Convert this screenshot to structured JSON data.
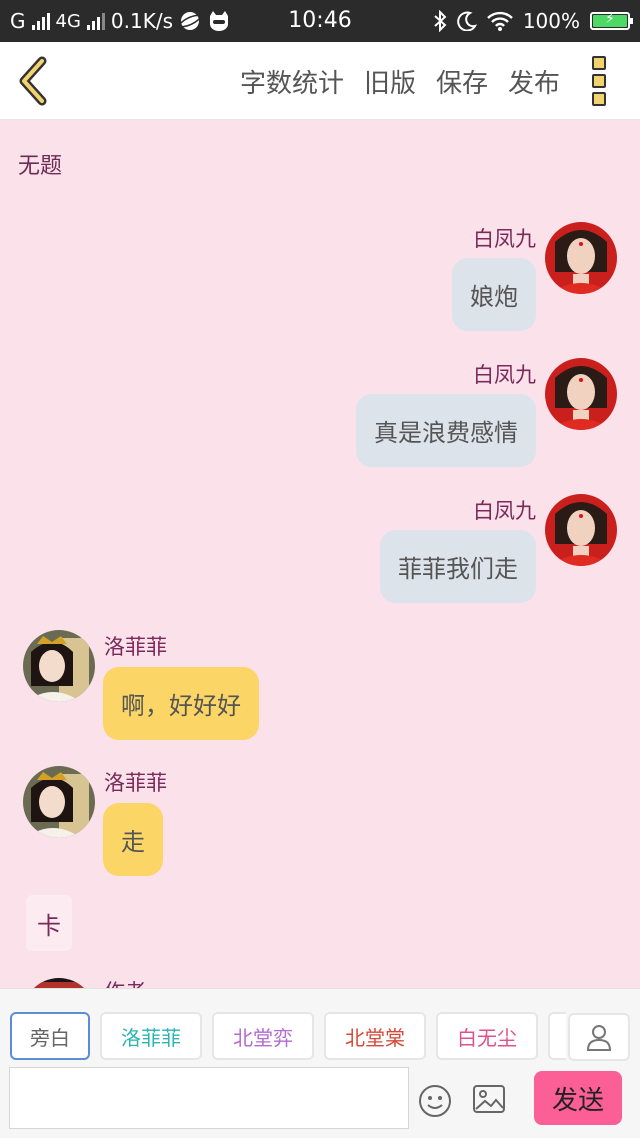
{
  "status_bar": {
    "carrier": "G",
    "network": "4G",
    "speed": "0.1K/s",
    "time": "10:46",
    "battery": "100%"
  },
  "nav": {
    "actions": [
      "字数统计",
      "旧版",
      "保存",
      "发布"
    ]
  },
  "document": {
    "title": "无题"
  },
  "messages": [
    {
      "side": "right",
      "name": "白凤九",
      "text": "娘炮"
    },
    {
      "side": "right",
      "name": "白凤九",
      "text": "真是浪费感情"
    },
    {
      "side": "right",
      "name": "白凤九",
      "text": "菲菲我们走"
    },
    {
      "side": "left",
      "name": "洛菲菲",
      "text": "啊，好好好"
    },
    {
      "side": "left",
      "name": "洛菲菲",
      "text": "走"
    }
  ],
  "narration": "卡",
  "partial_next_name": "作者",
  "roles": [
    {
      "label": "旁白",
      "color": "#666666"
    },
    {
      "label": "洛菲菲",
      "color": "#2bb5b0"
    },
    {
      "label": "北堂弈",
      "color": "#b36bcf"
    },
    {
      "label": "北堂棠",
      "color": "#d44a3a"
    },
    {
      "label": "白无尘",
      "color": "#e0528a"
    }
  ],
  "input": {
    "value": "",
    "placeholder": ""
  },
  "send_label": "发送",
  "colors": {
    "background": "#fae1ea",
    "right_bubble": "#dde3ea",
    "left_bubble": "#fbd565",
    "send_button": "#fb5f95",
    "name_text": "#7a2a5a"
  }
}
